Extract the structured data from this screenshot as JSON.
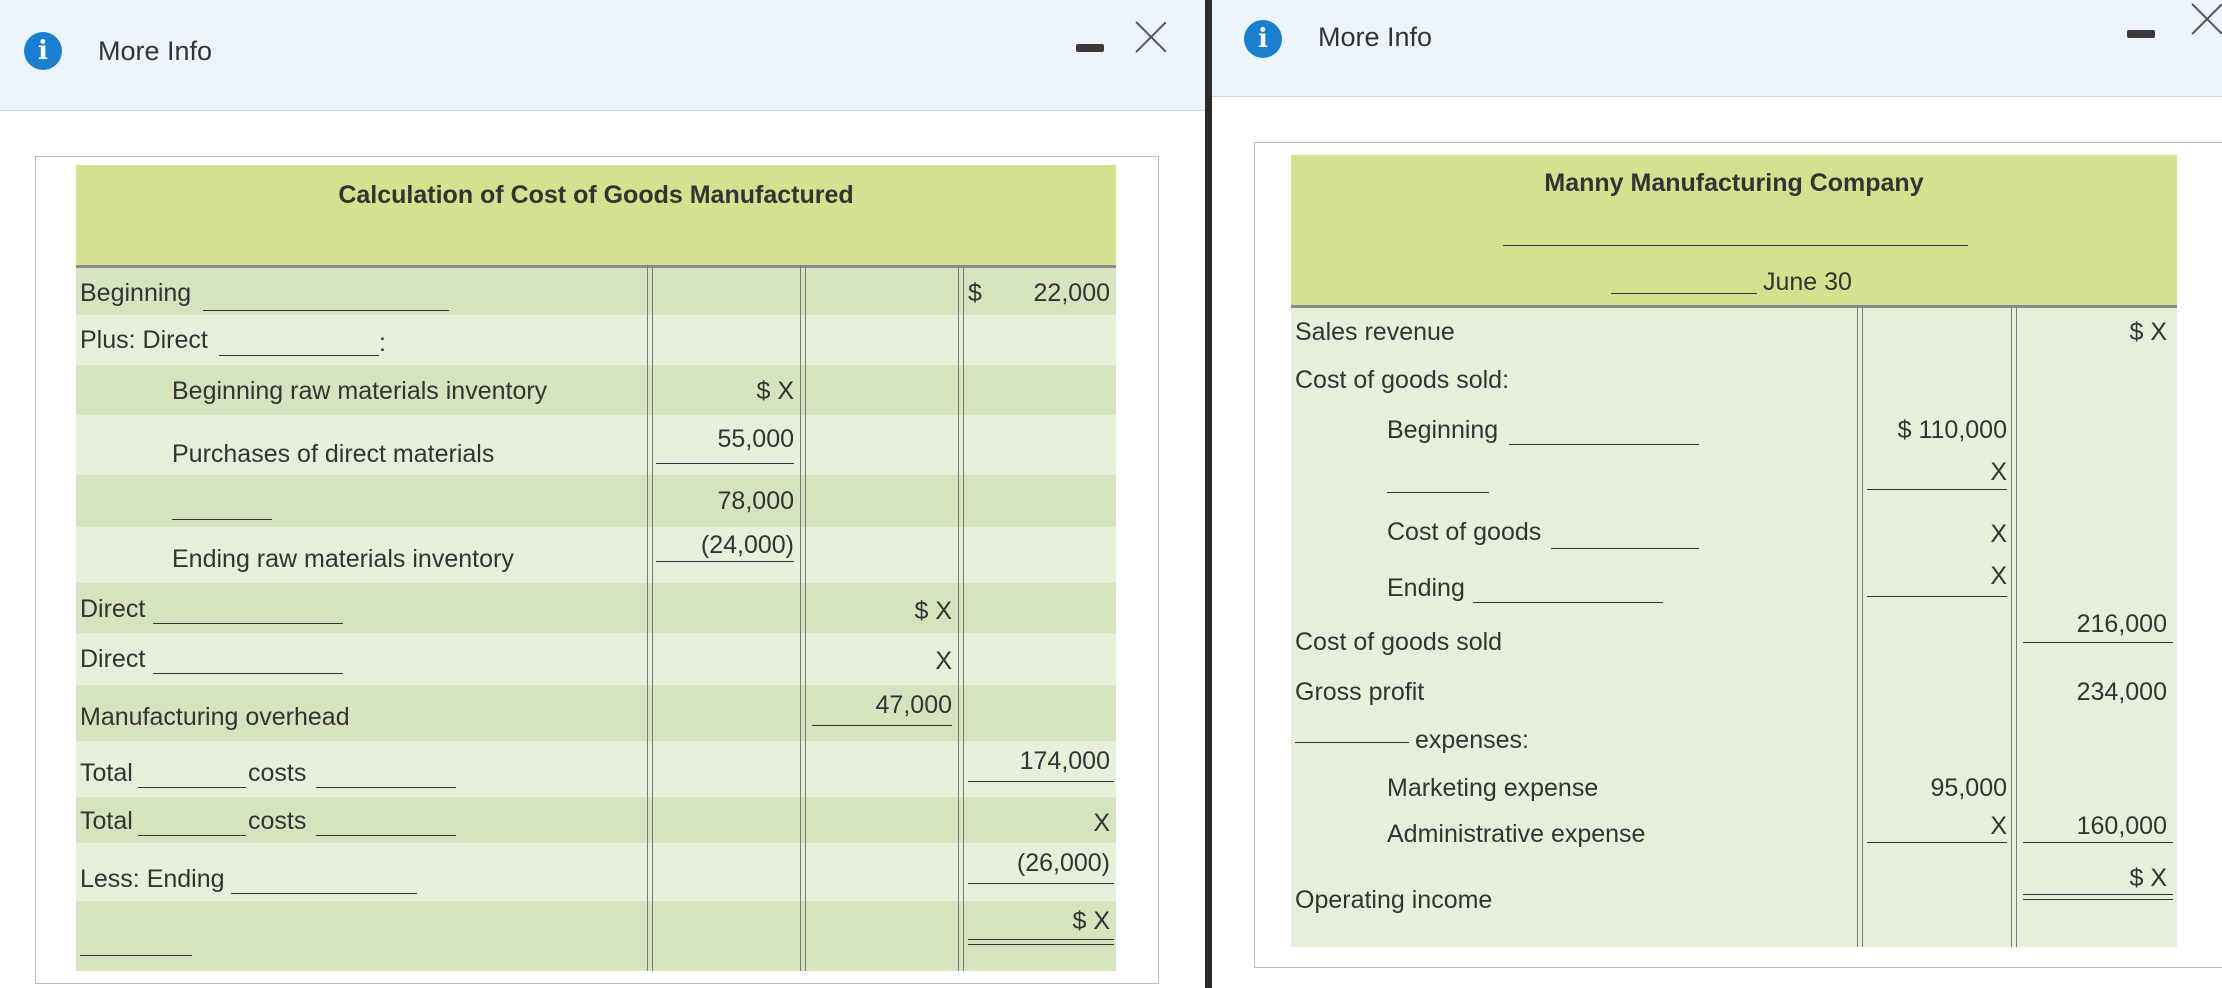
{
  "left_window": {
    "title": "More Info",
    "icons": {
      "info": "info-icon",
      "minimize": "minimize-icon",
      "close": "close-icon"
    },
    "table": {
      "title": "Calculation of Cost of Goods Manufactured",
      "rows": [
        {
          "label": "Beginning",
          "dollar": "$",
          "col3": "22,000"
        },
        {
          "label": "Plus: Direct",
          "suffix": ":"
        },
        {
          "label": "Beginning raw materials inventory",
          "col1": "$ X"
        },
        {
          "label": "Purchases of direct materials",
          "col1": "55,000"
        },
        {
          "label": "",
          "col1": "78,000"
        },
        {
          "label": "Ending raw materials inventory",
          "col1": "(24,000)"
        },
        {
          "label": "Direct",
          "col2": "$ X"
        },
        {
          "label": "Direct",
          "col2": "X"
        },
        {
          "label": "Manufacturing overhead",
          "col2": "47,000"
        },
        {
          "label": "Total",
          "mid": "costs",
          "col3": "174,000"
        },
        {
          "label": "Total",
          "mid": "costs",
          "col3": "X"
        },
        {
          "label": "Less: Ending",
          "col3": "(26,000)"
        },
        {
          "label": "",
          "col3": "$ X"
        }
      ]
    }
  },
  "right_window": {
    "title": "More Info",
    "icons": {
      "info": "info-icon",
      "minimize": "minimize-icon",
      "close": "close-icon"
    },
    "table": {
      "company": "Manny Manufacturing Company",
      "period": "June 30",
      "rows": [
        {
          "label": "Sales revenue",
          "col2": "$ X"
        },
        {
          "label": "Cost of goods sold:"
        },
        {
          "label": "Beginning",
          "col1": "$  110,000"
        },
        {
          "label": "",
          "col1": "X"
        },
        {
          "label": "Cost of goods",
          "col1": "X"
        },
        {
          "label": "Ending",
          "col1": "X"
        },
        {
          "label": "Cost of goods sold",
          "col2": "216,000"
        },
        {
          "label": "Gross profit",
          "col2": "234,000"
        },
        {
          "label": "expenses:"
        },
        {
          "label": "Marketing expense",
          "col1": "95,000"
        },
        {
          "label": "Administrative expense",
          "col1": "X",
          "col2": "160,000"
        },
        {
          "label": "Operating income",
          "col2": "$ X"
        }
      ]
    }
  }
}
